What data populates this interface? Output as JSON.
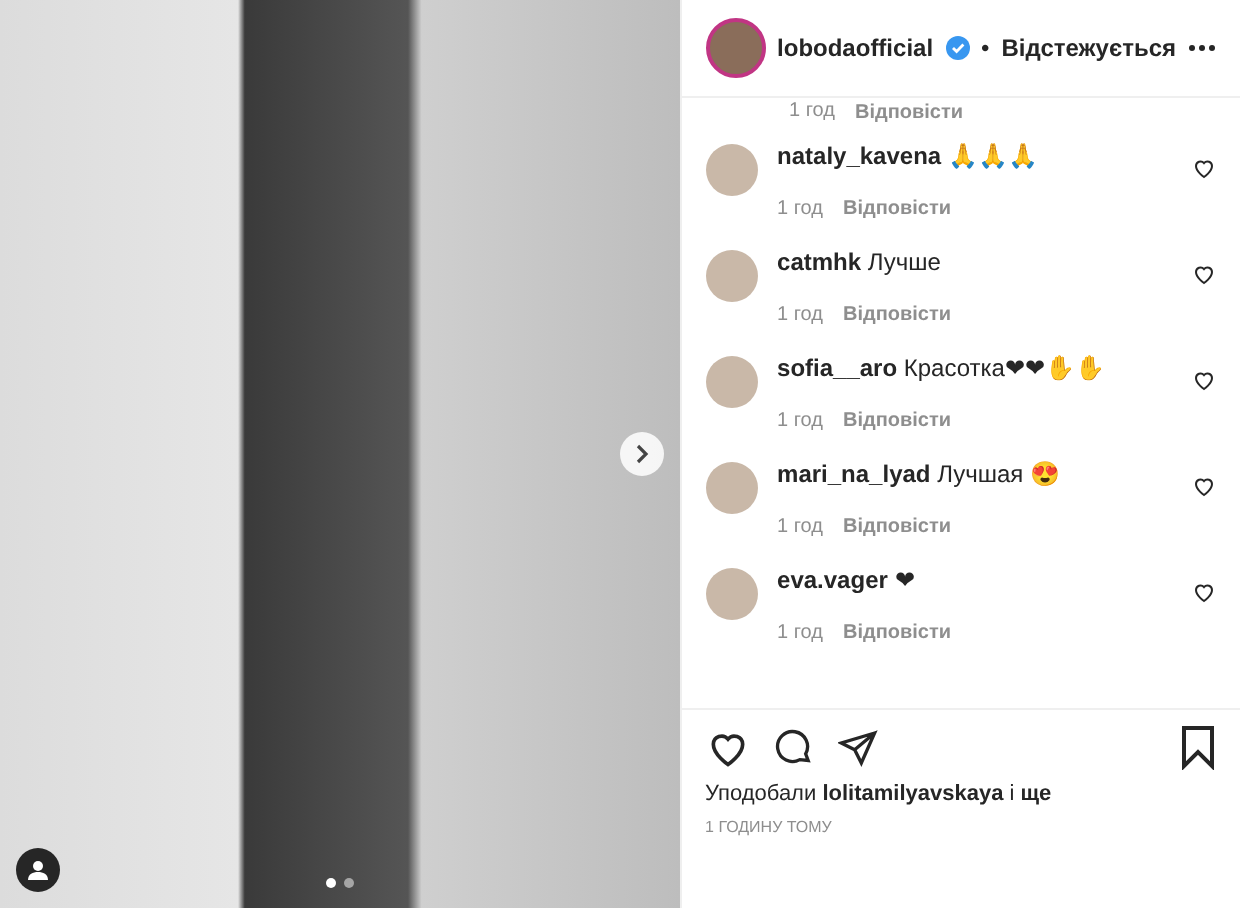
{
  "post": {
    "dots": [
      {
        "selected": true
      },
      {
        "selected": false
      }
    ]
  },
  "header": {
    "username": "lobodaofficial",
    "separator": "•",
    "follow_status": "Відстежується"
  },
  "cut_comment": {
    "time": "1 год",
    "reply": "Відповісти"
  },
  "comments": [
    {
      "text": "**nataly_kavena** 🙏🙏🙏",
      "time": "1 год",
      "reply": "Відповісти"
    },
    {
      "text": "**catmhk** Лучше",
      "time": "1 год",
      "reply": "Відповісти"
    },
    {
      "text": "**sofia__aro** Красотка❤❤✋✋",
      "time": "1 год",
      "reply": "Відповісти"
    },
    {
      "text": "**mari_na_lyad** Лучшая 😍",
      "time": "1 год",
      "reply": "Відповісти"
    },
    {
      "text": "**eva.vager** ❤",
      "time": "1 год",
      "reply": "Відповісти"
    }
  ],
  "likes": "Уподобали **lolitamilyavskaya** і **ще**",
  "posted": "1 ГОДИНУ ТОМУ"
}
